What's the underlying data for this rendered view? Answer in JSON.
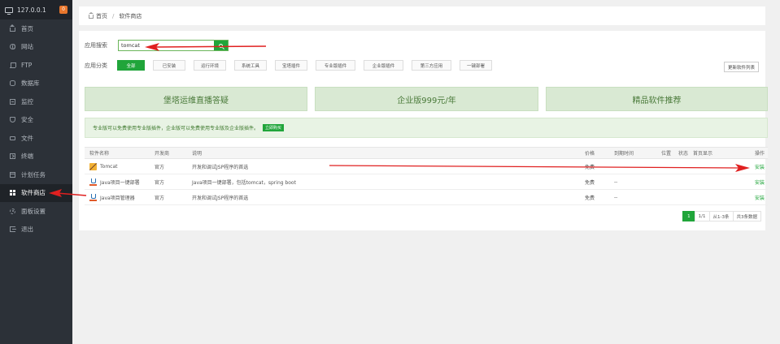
{
  "sidebar": {
    "ip": "127.0.0.1",
    "badge": "0",
    "items": [
      {
        "label": "首页",
        "icon": "home-icon"
      },
      {
        "label": "网站",
        "icon": "globe-icon"
      },
      {
        "label": "FTP",
        "icon": "ftp-icon"
      },
      {
        "label": "数据库",
        "icon": "database-icon"
      },
      {
        "label": "监控",
        "icon": "monitor-icon"
      },
      {
        "label": "安全",
        "icon": "shield-icon"
      },
      {
        "label": "文件",
        "icon": "folder-icon"
      },
      {
        "label": "终端",
        "icon": "terminal-icon"
      },
      {
        "label": "计划任务",
        "icon": "calendar-icon"
      },
      {
        "label": "软件商店",
        "icon": "grid-icon"
      },
      {
        "label": "面板设置",
        "icon": "gear-icon"
      },
      {
        "label": "退出",
        "icon": "exit-icon"
      }
    ]
  },
  "breadcrumb": {
    "home": "首页",
    "separator": "/",
    "current": "软件商店"
  },
  "search": {
    "label": "应用搜索",
    "value": "tomcat"
  },
  "categories": {
    "label": "应用分类",
    "items": [
      "全部",
      "已安装",
      "运行环境",
      "系统工具",
      "宝塔插件",
      "专业版插件",
      "企业版插件",
      "第三方应用",
      "一键部署"
    ],
    "update_label": "更新软件列表"
  },
  "banners": [
    "堡塔运维直播答疑",
    "企业版999元/年",
    "精品软件推荐"
  ],
  "notice": {
    "text": "专业版可以免费使用专业版插件，企业版可以免费使用专业版及企业版插件。",
    "button": "立即购买"
  },
  "table": {
    "headers": [
      "软件名称",
      "开发商",
      "说明",
      "价格",
      "到期时间",
      "位置",
      "状态",
      "首页显示",
      "操作"
    ],
    "rows": [
      {
        "name": "Tomcat",
        "dev": "官方",
        "desc": "开发和调试JSP程序的首选",
        "price": "免费",
        "expire": "",
        "action": "安装"
      },
      {
        "name": "Java项目一键部署",
        "dev": "官方",
        "desc": "Java项目一键部署，包括tomcat，spring boot",
        "price": "免费",
        "expire": "--",
        "action": "安装"
      },
      {
        "name": "Java项目管理器",
        "dev": "官方",
        "desc": "开发和调试JSP程序的首选",
        "price": "免费",
        "expire": "--",
        "action": "安装"
      }
    ]
  },
  "pager": {
    "current": "1",
    "pages": "1/1",
    "range": "从1-3条",
    "total": "共3条数据"
  },
  "colors": {
    "accent": "#20a53a",
    "arrow": "#e02020",
    "sidebar_bg": "#2c3138"
  }
}
